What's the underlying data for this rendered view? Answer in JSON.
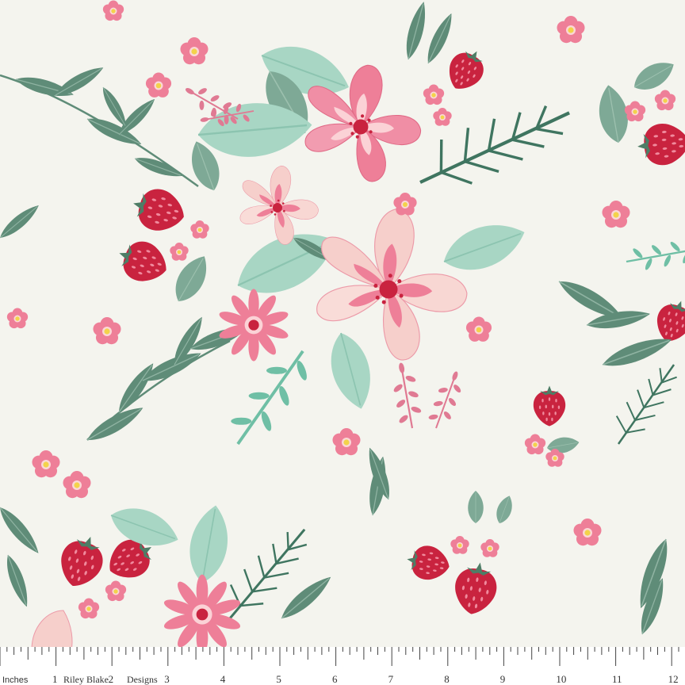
{
  "fabric": {
    "background_color": "#f4f4ee",
    "motifs": [
      "pink-flower-icon",
      "blush-flower-icon",
      "small-pink-blossom-icon",
      "strawberry-icon",
      "sage-leaf-icon",
      "mint-leaf-icon",
      "fern-frond-icon",
      "berry-sprig-icon",
      "daisy-icon"
    ],
    "palette": {
      "pink": "#ee7f98",
      "blush": "#f6cfcb",
      "deep_red": "#c9233f",
      "sage": "#5f8c78",
      "mint": "#a8d6c4",
      "yellow": "#f3d34a"
    }
  },
  "ruler": {
    "unit_label": "Inches",
    "brand_left": "Riley Blake",
    "brand_right": "Designs",
    "numbers": [
      "1",
      "2",
      "3",
      "4",
      "5",
      "6",
      "7",
      "8",
      "9",
      "10",
      "11",
      "12"
    ]
  }
}
